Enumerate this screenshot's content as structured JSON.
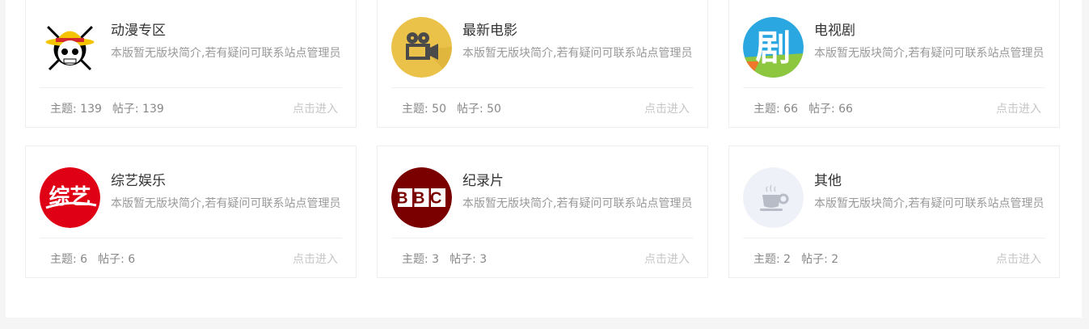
{
  "boards": [
    {
      "title": "动漫专区",
      "desc": "本版暂无版块简介,若有疑问可联系站点管理员",
      "topics_label": "主题: 139",
      "posts_label": "帖子: 139",
      "enter": "点击进入",
      "icon": "straw-hat-skull-icon",
      "color": "#000000"
    },
    {
      "title": "最新电影",
      "desc": "本版暂无版块简介,若有疑问可联系站点管理员",
      "topics_label": "主题: 50",
      "posts_label": "帖子: 50",
      "enter": "点击进入",
      "icon": "film-camera-icon",
      "color": "#eac24a"
    },
    {
      "title": "电视剧",
      "desc": "本版暂无版块简介,若有疑问可联系站点管理员",
      "topics_label": "主题: 66",
      "posts_label": "帖子: 66",
      "enter": "点击进入",
      "icon": "drama-icon",
      "color": "#2aa7e0",
      "icon_text": "剧"
    },
    {
      "title": "综艺娱乐",
      "desc": "本版暂无版块简介,若有疑问可联系站点管理员",
      "topics_label": "主题: 6",
      "posts_label": "帖子: 6",
      "enter": "点击进入",
      "icon": "variety-icon",
      "color": "#e00015",
      "icon_text": "综艺"
    },
    {
      "title": "纪录片",
      "desc": "本版暂无版块简介,若有疑问可联系站点管理员",
      "topics_label": "主题: 3",
      "posts_label": "帖子: 3",
      "enter": "点击进入",
      "icon": "bbc-logo-icon",
      "color": "#7a0000",
      "icon_text": "BBC"
    },
    {
      "title": "其他",
      "desc": "本版暂无版块简介,若有疑问可联系站点管理员",
      "topics_label": "主题: 2",
      "posts_label": "帖子: 2",
      "enter": "点击进入",
      "icon": "coffee-cup-icon",
      "color": "#eef1f7"
    }
  ]
}
